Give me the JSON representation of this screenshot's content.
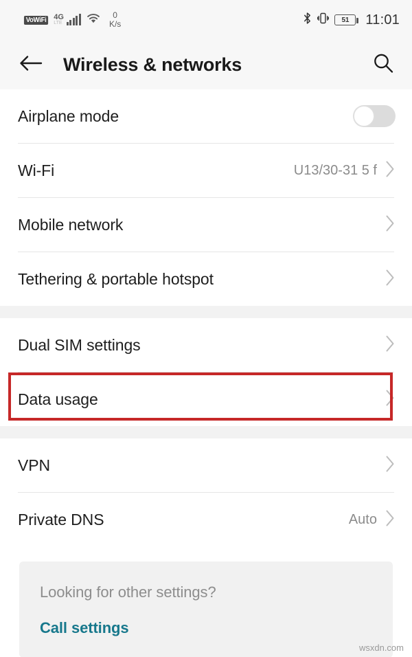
{
  "status_bar": {
    "vowifi_label": "VoWiFi",
    "network_type": "4G",
    "network_sub": "LTE",
    "data_rate_value": "0",
    "data_rate_unit": "K/s",
    "battery_level": "51",
    "time": "11:01",
    "icons": {
      "signal": "signal-bars-icon",
      "wifi": "wifi-icon",
      "bluetooth": "bluetooth-icon",
      "vibrate": "vibrate-icon",
      "battery": "battery-icon"
    }
  },
  "app_bar": {
    "title": "Wireless & networks",
    "back_icon": "back-arrow-icon",
    "search_icon": "search-icon"
  },
  "sections": [
    {
      "rows": [
        {
          "label": "Airplane mode",
          "type": "toggle",
          "toggle_on": false
        },
        {
          "label": "Wi-Fi",
          "value": "U13/30-31 5 f",
          "type": "link"
        },
        {
          "label": "Mobile network",
          "value": "",
          "type": "link"
        },
        {
          "label": "Tethering & portable hotspot",
          "value": "",
          "type": "link"
        }
      ]
    },
    {
      "rows": [
        {
          "label": "Dual SIM settings",
          "value": "",
          "type": "link"
        },
        {
          "label": "Data usage",
          "value": "",
          "type": "link",
          "highlighted": true
        }
      ]
    },
    {
      "rows": [
        {
          "label": "VPN",
          "value": "",
          "type": "link"
        },
        {
          "label": "Private DNS",
          "value": "Auto",
          "type": "link"
        }
      ]
    }
  ],
  "footer": {
    "question": "Looking for other settings?",
    "link": "Call settings"
  },
  "watermark": "wsxdn.com",
  "colors": {
    "accent_link": "#17788c",
    "highlight_border": "#c62828",
    "header_bg": "#f7f7f7",
    "group_gap_bg": "#f2f2f2",
    "card_bg": "#f1f1f1"
  }
}
